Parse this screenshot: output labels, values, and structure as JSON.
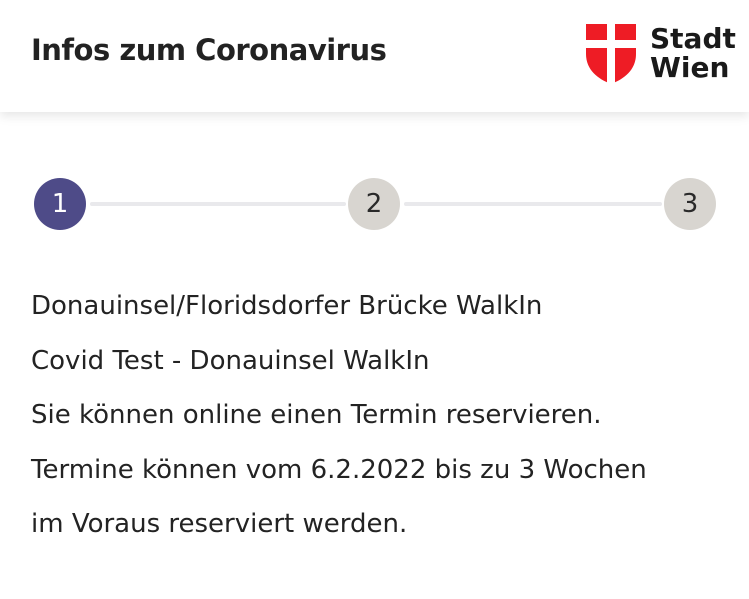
{
  "header": {
    "title": "Infos zum Coronavirus",
    "logo": {
      "line1": "Stadt",
      "line2": "Wien",
      "shield_color": "#ee1c25"
    }
  },
  "stepper": {
    "steps": [
      {
        "label": "1",
        "state": "active"
      },
      {
        "label": "2",
        "state": "inactive"
      },
      {
        "label": "3",
        "state": "inactive"
      }
    ],
    "active_color": "#4e4b88",
    "inactive_color": "#d8d5d0"
  },
  "content": {
    "location": "Donauinsel/Floridsdorfer Brücke WalkIn",
    "test_name": "Covid Test - Donauinsel WalkIn",
    "info_line": "Sie können online einen Termin reservieren.",
    "terms_line1": "Termine können vom 6.2.2022 bis zu 3 Wochen",
    "terms_line2": "im Voraus reserviert werden."
  }
}
